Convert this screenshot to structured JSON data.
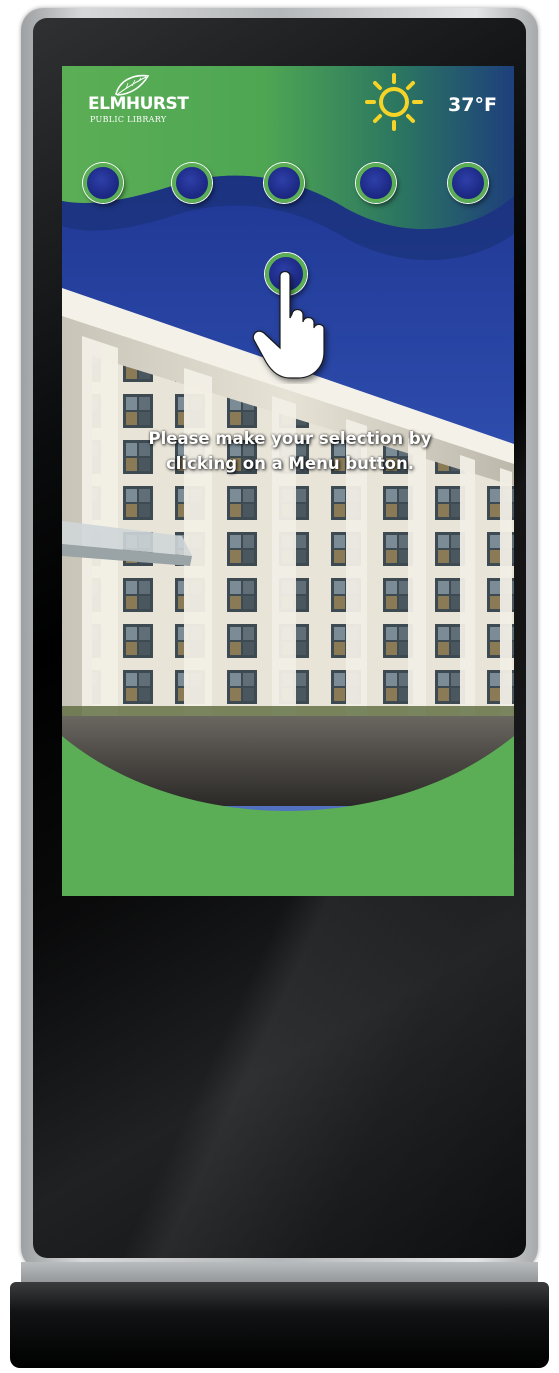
{
  "library": {
    "name": "ELMHURST",
    "subtitle": "PUBLIC LIBRARY"
  },
  "weather": {
    "icon": "sun-icon",
    "temperature": "37°F"
  },
  "menu": {
    "button_count": 5
  },
  "instruction": {
    "line1": "Please make your selection by",
    "line2": "clicking on a Menu button."
  },
  "colors": {
    "brand_green": "#5bae55",
    "menu_button_blue": "#1d2a86",
    "sun_yellow": "#f5d327",
    "header_dark_blue": "#1e3f7c"
  }
}
